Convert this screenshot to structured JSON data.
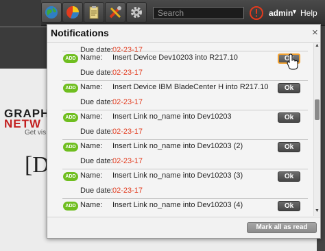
{
  "toolbar": {
    "buttons": [
      {
        "icon": "globe-icon"
      },
      {
        "icon": "chart-icon"
      },
      {
        "icon": "clipboard-icon"
      },
      {
        "icon": "tools-icon"
      },
      {
        "icon": "gear-icon"
      }
    ],
    "search_placeholder": "Search",
    "alert_icon": "power-alert-icon",
    "user_label": "admin",
    "help_label": "Help"
  },
  "background": {
    "logo_line1": "GRAPH",
    "logo_line2": "NETW",
    "tagline": "Get vis",
    "heading": "[D"
  },
  "notifications": {
    "title": "Notifications",
    "close_label": "×",
    "name_label": "Name:",
    "due_label": "Due date:",
    "badge_label": "ADD",
    "ok_label": "Ok",
    "partial_due_label": "Due date:",
    "partial_due_value": "02-23-17",
    "items": [
      {
        "name": "Insert Device Dev10203 into R217.10",
        "due": "02-23-17"
      },
      {
        "name": "Insert Device IBM BladeCenter H into R217.10",
        "due": "02-23-17"
      },
      {
        "name": "Insert Link no_name into Dev10203",
        "due": "02-23-17"
      },
      {
        "name": "Insert Link no_name into Dev10203 (2)",
        "due": "02-23-17"
      },
      {
        "name": "Insert Link no_name into Dev10203 (3)",
        "due": "02-23-17"
      },
      {
        "name": "Insert Link no_name into Dev10203 (4)",
        "due": ""
      }
    ],
    "mark_all_label": "Mark all as read"
  },
  "colors": {
    "accent_green": "#6fbe1f",
    "due_red": "#e23b1e",
    "toolbar_dark": "#3a3a3a",
    "hover_orange": "#f0a030"
  }
}
